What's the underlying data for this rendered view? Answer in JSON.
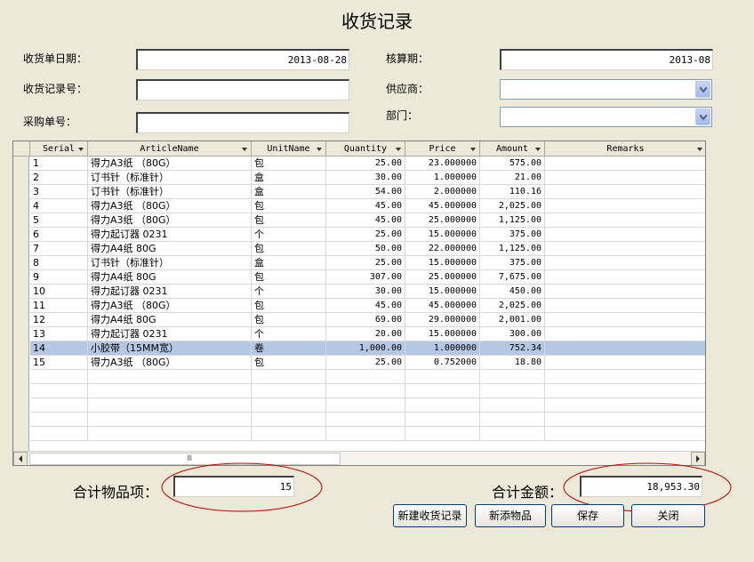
{
  "title": "收货记录",
  "form": {
    "date_label": "收货单日期：",
    "date_value": "2013-08-28",
    "record_label": "收货记录号：",
    "record_value": "",
    "po_label": "采购单号：",
    "po_value": "",
    "period_label": "核算期：",
    "period_value": "2013-08",
    "supplier_label": "供应商：",
    "supplier_value": "",
    "dept_label": "部门：",
    "dept_value": ""
  },
  "grid": {
    "columns": [
      "Serial",
      "ArticleName",
      "UnitName",
      "Quantity",
      "Price",
      "Amount",
      "Remarks"
    ],
    "rows": [
      [
        "1",
        "得力A3纸 （80G）",
        "包",
        "25.00",
        "23.000000",
        "575.00",
        ""
      ],
      [
        "2",
        "订书针（标准针）",
        "盒",
        "30.00",
        "1.000000",
        "21.00",
        ""
      ],
      [
        "3",
        "订书针（标准针）",
        "盒",
        "54.00",
        "2.000000",
        "110.16",
        ""
      ],
      [
        "4",
        "得力A3纸 （80G）",
        "包",
        "45.00",
        "45.000000",
        "2,025.00",
        ""
      ],
      [
        "5",
        "得力A3纸 （80G）",
        "包",
        "45.00",
        "25.000000",
        "1,125.00",
        ""
      ],
      [
        "6",
        "得力起订器 0231",
        "个",
        "25.00",
        "15.000000",
        "375.00",
        ""
      ],
      [
        "7",
        "得力A4纸 80G",
        "包",
        "50.00",
        "22.000000",
        "1,125.00",
        ""
      ],
      [
        "8",
        "订书针（标准针）",
        "盒",
        "25.00",
        "15.000000",
        "375.00",
        ""
      ],
      [
        "9",
        "得力A4纸 80G",
        "包",
        "307.00",
        "25.000000",
        "7,675.00",
        ""
      ],
      [
        "10",
        "得力起订器 0231",
        "个",
        "30.00",
        "15.000000",
        "450.00",
        ""
      ],
      [
        "11",
        "得力A3纸 （80G）",
        "包",
        "45.00",
        "45.000000",
        "2,025.00",
        ""
      ],
      [
        "12",
        "得力A4纸 80G",
        "包",
        "69.00",
        "29.000000",
        "2,001.00",
        ""
      ],
      [
        "13",
        "得力起订器 0231",
        "个",
        "20.00",
        "15.000000",
        "300.00",
        ""
      ],
      [
        "14",
        "小胶带（15MM宽）",
        "卷",
        "1,000.00",
        "1.000000",
        "752.34",
        ""
      ],
      [
        "15",
        "得力A3纸 （80G）",
        "包",
        "25.00",
        "0.752000",
        "18.80",
        ""
      ]
    ],
    "selected_row": 13,
    "scroll_thumb": "Ⅲ"
  },
  "footer": {
    "count_label": "合计物品项：",
    "count_value": "15",
    "amount_label": "合计金额：",
    "amount_value": "18,953.30"
  },
  "buttons": {
    "new_record": "新建收货记录",
    "add_item": "新添物品",
    "save": "保存",
    "close": "关闭"
  },
  "colors": {
    "background": "#ece9d8",
    "selected_row": "#b4c8e4",
    "highlight_ellipse": "#c00000"
  }
}
